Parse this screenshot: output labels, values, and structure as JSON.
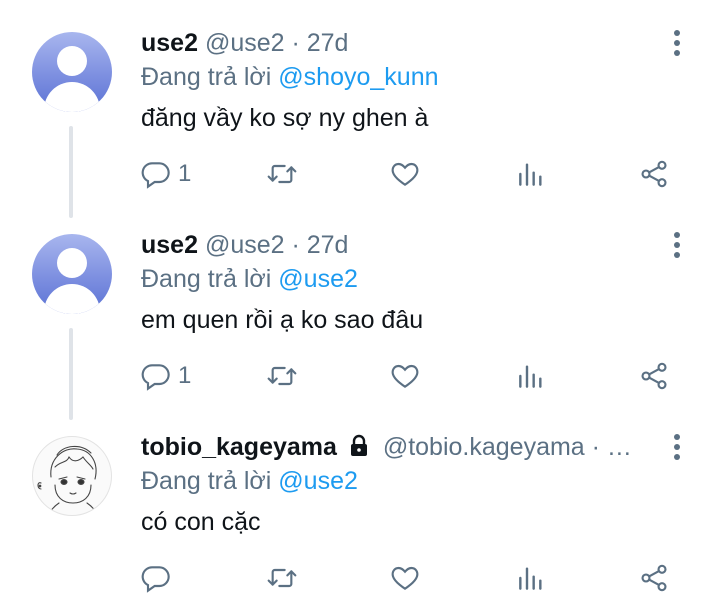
{
  "replying_prefix": "Đang trả lời",
  "tweets": [
    {
      "name": "use2",
      "handle_time": "@use2 · 27d",
      "reply_to": "@shoyo_kunn",
      "text": "đăng vầy ko sợ ny ghen à",
      "reply_count": "1"
    },
    {
      "name": "use2",
      "handle_time": "@use2 · 27d",
      "reply_to": "@use2",
      "text": "em quen rồi ạ ko sao đâu",
      "reply_count": "1"
    },
    {
      "name": "tobio_kageyama",
      "handle_time": "@tobio.kageyama · …",
      "reply_to": "@use2",
      "text": "có con cặc",
      "reply_count": ""
    }
  ],
  "colors": {
    "accent": "#1d9bf0",
    "muted": "#5b7083",
    "text": "#0f1419"
  },
  "icons": [
    "reply-icon",
    "retweet-icon",
    "like-icon",
    "views-icon",
    "share-icon",
    "more-icon",
    "lock-icon"
  ]
}
